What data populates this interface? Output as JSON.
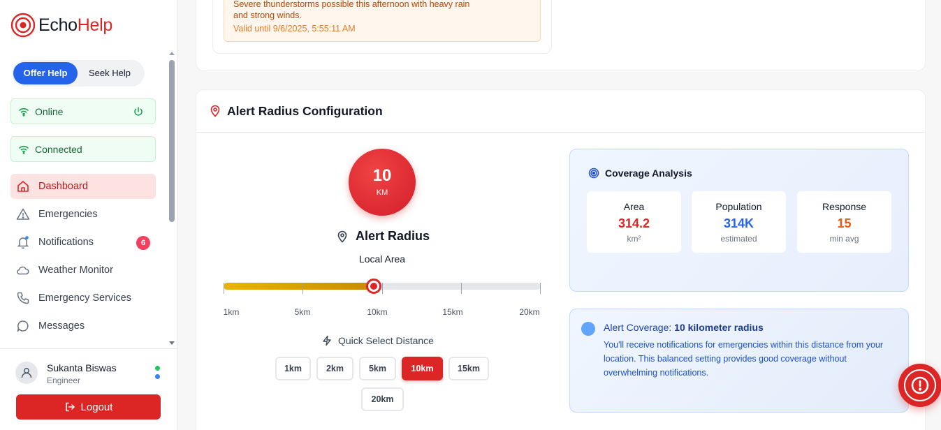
{
  "brand": {
    "name_part1": "Echo",
    "name_part2": "Help",
    "accent": "#dc2626"
  },
  "mode_toggle": {
    "active": "Offer Help",
    "inactive": "Seek Help"
  },
  "status": {
    "online": "Online",
    "connected": "Connected"
  },
  "nav": {
    "items": [
      {
        "label": "Dashboard",
        "icon": "home-icon",
        "active": true
      },
      {
        "label": "Emergencies",
        "icon": "warning-icon"
      },
      {
        "label": "Notifications",
        "icon": "bell-icon",
        "badge": "6"
      },
      {
        "label": "Weather Monitor",
        "icon": "cloud-icon"
      },
      {
        "label": "Emergency Services",
        "icon": "phone-icon"
      },
      {
        "label": "Messages",
        "icon": "chat-icon"
      }
    ]
  },
  "user": {
    "name": "Sukanta Biswas",
    "role": "Engineer",
    "logout_label": "Logout"
  },
  "weather_alert": {
    "description": "Severe thunderstorms possible this afternoon with heavy rain and strong winds.",
    "valid_until": "Valid until 9/6/2025, 5:55:11 AM"
  },
  "alert_radius": {
    "section_title": "Alert Radius Configuration",
    "value": "10",
    "unit": "KM",
    "heading": "Alert Radius",
    "area_label": "Local Area",
    "slider": {
      "min": 1,
      "max": 20,
      "current": 10,
      "tick_labels": [
        "1km",
        "5km",
        "10km",
        "15km",
        "20km"
      ]
    },
    "quick_select_title": "Quick Select Distance",
    "quick_options": [
      "1km",
      "2km",
      "5km",
      "10km",
      "15km",
      "20km"
    ],
    "selected_option": "10km"
  },
  "coverage": {
    "title": "Coverage Analysis",
    "stats": [
      {
        "label": "Area",
        "value": "314.2",
        "sub": "km²",
        "color": "#dc2626"
      },
      {
        "label": "Population",
        "value": "314K",
        "sub": "estimated",
        "color": "#2563eb"
      },
      {
        "label": "Response",
        "value": "15",
        "sub": "min avg",
        "color": "#ea580c"
      }
    ]
  },
  "coverage_info": {
    "title_prefix": "Alert Coverage:",
    "title_value": "10 kilometer radius",
    "text": "You'll receive notifications for emergencies within this distance from your location. This balanced setting provides good coverage without overwhelming notifications."
  },
  "sos": {
    "icon": "alert-circle-icon"
  }
}
